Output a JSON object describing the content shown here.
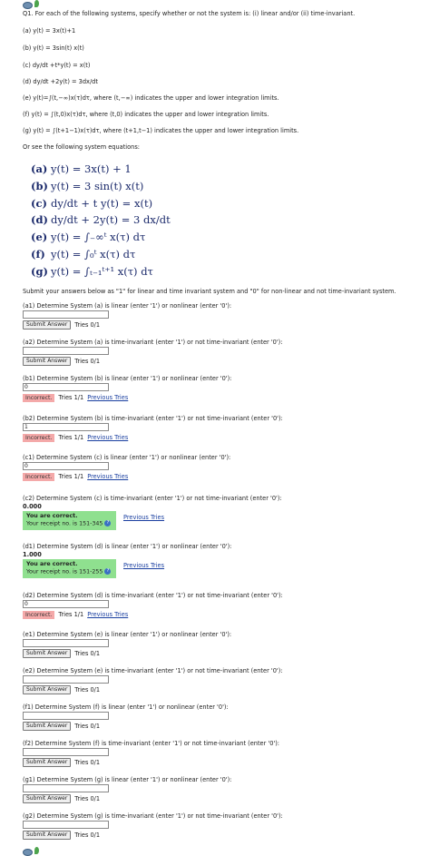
{
  "intro": "Q1. For each of the following systems, specify whether or not the system is: (i) linear and/or (ii) time-invariant.",
  "systems_text": [
    "(a) y(t) = 3x(t)+1",
    "(b) y(t) = 3sin(t) x(t)",
    "(c) dy/dt +t*y(t) = x(t)",
    "(d) dy/dt +2y(t) = 3dx/dt",
    "(e) y(t)=∫(t,−∞)x(τ)dτ, where (t,−∞) indicates the upper and lower integration limits.",
    "(f) y(t) = ∫(t,0)x(τ)dτ, where (t,0) indicates the upper and lower integration limits.",
    "(g) y(t) = ∫(t+1−1)x(τ)dτ, where (t+1,t−1) indicates the upper and lower integration limits."
  ],
  "or_see": "Or see the following system equations:",
  "equations": [
    {
      "label": "(a)",
      "expr": "y(t) = 3x(t) + 1"
    },
    {
      "label": "(b)",
      "expr": "y(t) = 3 sin(t) x(t)"
    },
    {
      "label": "(c)",
      "expr": "dy/dt + t y(t) = x(t)"
    },
    {
      "label": "(d)",
      "expr": "dy/dt + 2y(t) = 3 dx/dt"
    },
    {
      "label": "(e)",
      "expr": "y(t) = ∫₋∞ᵗ x(τ) dτ"
    },
    {
      "label": "(f)",
      "expr": "y(t) = ∫₀ᵗ x(τ) dτ"
    },
    {
      "label": "(g)",
      "expr": "y(t) = ∫ₜ₋₁ᵗ⁺¹ x(τ) dτ"
    }
  ],
  "instructions": "Submit your answers below as \"1\" for linear and time invariant system and \"0\" for non-linear and not time-invariant system.",
  "labels": {
    "submit": "Submit Answer",
    "tries0": "Tries 0/1",
    "tries1": "Tries 1/1",
    "incorrect": "Incorrect.",
    "previous": "Previous Tries",
    "correct": "You are correct.",
    "help": "?"
  },
  "questions": {
    "a1": {
      "label": "(a1) Determine System (a) is linear (enter '1') or nonlinear (enter '0'):"
    },
    "a2": {
      "label": "(a2) Determine System (a) is time-invariant (enter '1') or not time-invariant (enter '0'):"
    },
    "b1": {
      "label": "(b1) Determine System (b) is linear (enter '1') or nonlinear (enter '0'):",
      "value": "0"
    },
    "b2": {
      "label": "(b2) Determine System (b) is time-invariant (enter '1') or not time-invariant (enter '0'):",
      "value": "1"
    },
    "c1": {
      "label": "(c1) Determine System (c) is linear (enter '1') or nonlinear (enter '0'):",
      "value": "0"
    },
    "c2": {
      "label": "(c2) Determine System (c) is time-invariant (enter '1') or not time-invariant (enter '0'):",
      "value": "0.000",
      "receipt": "Your receipt no. is 151-345"
    },
    "d1": {
      "label": "(d1) Determine System (d) is linear (enter '1') or nonlinear (enter '0'):",
      "value": "1.000",
      "receipt": "Your receipt no. is 151-255"
    },
    "d2": {
      "label": "(d2) Determine System (d) is time-invariant (enter '1') or not time-invariant (enter '0'):",
      "value": "0"
    },
    "e1": {
      "label": "(e1) Determine System (e) is linear (enter '1') or nonlinear (enter '0'):"
    },
    "e2": {
      "label": "(e2) Determine System (e) is time-invariant (enter '1') or not time-invariant (enter '0'):"
    },
    "f1": {
      "label": "(f1) Determine System (f) is linear (enter '1') or nonlinear (enter '0'):"
    },
    "f2": {
      "label": "(f2) Determine System (f) is time-invariant (enter '1') or not time-invariant (enter '0'):"
    },
    "g1": {
      "label": "(g1) Determine System (g) is linear (enter '1') or nonlinear (enter '0'):"
    },
    "g2": {
      "label": "(g2) Determine System (g) is time-invariant (enter '1') or not time-invariant (enter '0'):"
    }
  }
}
